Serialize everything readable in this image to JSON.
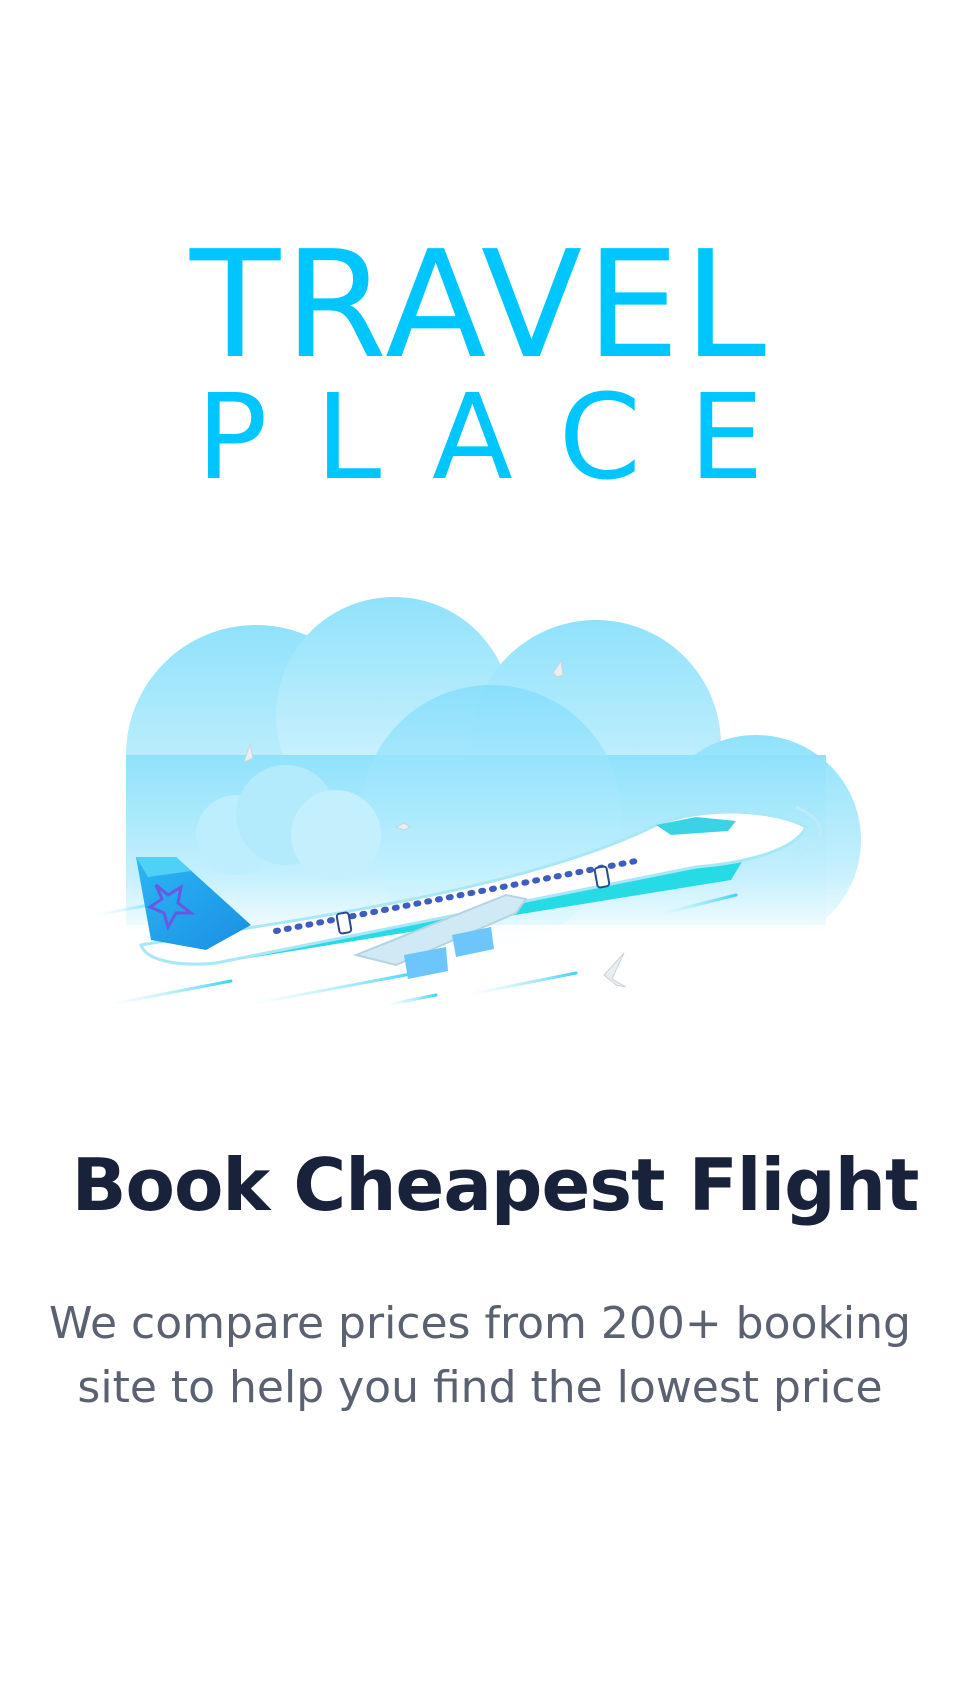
{
  "app": {
    "logo_line1": "TRAVEL",
    "logo_line2": "PLACE",
    "brand_color": "#00c6ff"
  },
  "hero": {
    "illustration_icon": "airplane-in-clouds-icon"
  },
  "onboarding": {
    "title": "Book Cheapest Flight",
    "description": "We compare prices from 200+ booking site to help you find the lowest price",
    "title_color": "#18223a",
    "description_color": "#5a6170"
  }
}
